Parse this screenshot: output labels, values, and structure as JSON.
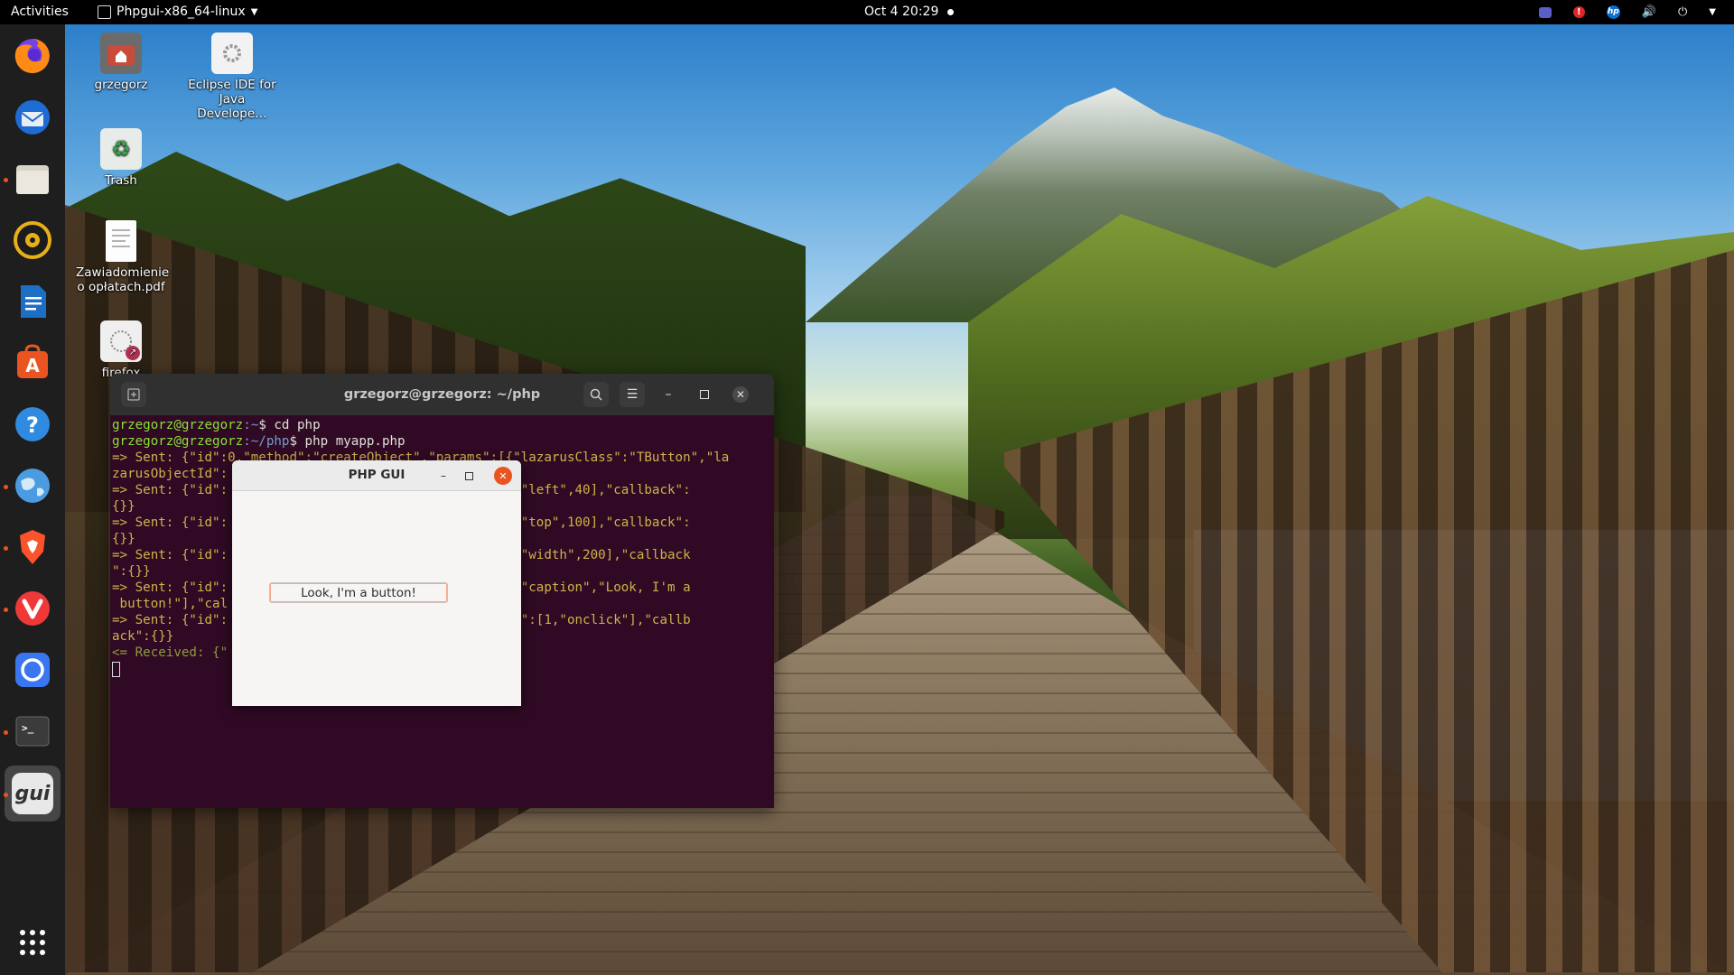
{
  "topbar": {
    "activities": "Activities",
    "app_menu": "Phpgui-x86_64-linux",
    "clock": "Oct 4  20:29"
  },
  "dock": {
    "items": [
      {
        "name": "Firefox",
        "icon": "firefox-icon",
        "running": false
      },
      {
        "name": "Thunderbird",
        "icon": "thunderbird-icon",
        "running": false
      },
      {
        "name": "Files",
        "icon": "files-icon",
        "running": true
      },
      {
        "name": "Rhythmbox",
        "icon": "rhythmbox-icon",
        "running": false
      },
      {
        "name": "LibreOffice Writer",
        "icon": "writer-icon",
        "running": false
      },
      {
        "name": "Ubuntu Software",
        "icon": "software-icon",
        "running": false
      },
      {
        "name": "Help",
        "icon": "help-icon",
        "running": false
      },
      {
        "name": "Globe app",
        "icon": "globe-icon",
        "running": true
      },
      {
        "name": "Brave",
        "icon": "brave-icon",
        "running": true
      },
      {
        "name": "Vivaldi",
        "icon": "vivaldi-icon",
        "running": true
      },
      {
        "name": "Signal",
        "icon": "signal-icon",
        "running": false
      },
      {
        "name": "Terminal",
        "icon": "terminal-icon",
        "running": true
      },
      {
        "name": "Phpgui",
        "icon": "gui-icon",
        "running": true,
        "active": true,
        "label": "gui"
      }
    ],
    "show_apps_icon": "grid-icon"
  },
  "desktop": {
    "icons": [
      {
        "label": "grzegorz",
        "icon": "home-folder-icon"
      },
      {
        "label": "Eclipse IDE for Java Develope…",
        "icon": "eclipse-icon"
      },
      {
        "label": "Trash",
        "icon": "trash-icon"
      },
      {
        "label": "Zawiadomienie o opłatach.pdf",
        "icon": "pdf-document-icon"
      },
      {
        "label": "firefox",
        "icon": "firefox-shortcut-icon"
      }
    ]
  },
  "terminal": {
    "title": "grzegorz@grzegorz: ~/php",
    "lines": [
      {
        "user": "grzegorz@grzegorz",
        "path": ":~",
        "cmd": "$ cd php"
      },
      {
        "user": "grzegorz@grzegorz",
        "path": ":~/php",
        "cmd": "$ php myapp.php"
      },
      {
        "out": "=> Sent: {\"id\":0,\"method\":\"createObject\",\"params\":[{\"lazarusClass\":\"TButton\",\"la"
      },
      {
        "out": "zarusObjectId\":"
      },
      {
        "out": "=> Sent: {\"id\":                              ams\":[1,\"left\",40],\"callback\":"
      },
      {
        "out": "{}}"
      },
      {
        "out": "=> Sent: {\"id\":                              ams\":[1,\"top\",100],\"callback\":"
      },
      {
        "out": "{}}"
      },
      {
        "out": "=> Sent: {\"id\":                              ams\":[1,\"width\",200],\"callback"
      },
      {
        "out": "\":{}}"
      },
      {
        "out": "=> Sent: {\"id\":                              ams\":[1,\"caption\",\"Look, I'm a"
      },
      {
        "out": " button!\"],\"cal"
      },
      {
        "out": "=> Sent: {\"id\":                              ,\"params\":[1,\"onclick\"],\"callb"
      },
      {
        "out": "ack\":{}}"
      },
      {
        "in": "<= Received: {\""
      }
    ]
  },
  "phpgui": {
    "title": "PHP GUI",
    "button_label": "Look, I'm a button!"
  }
}
